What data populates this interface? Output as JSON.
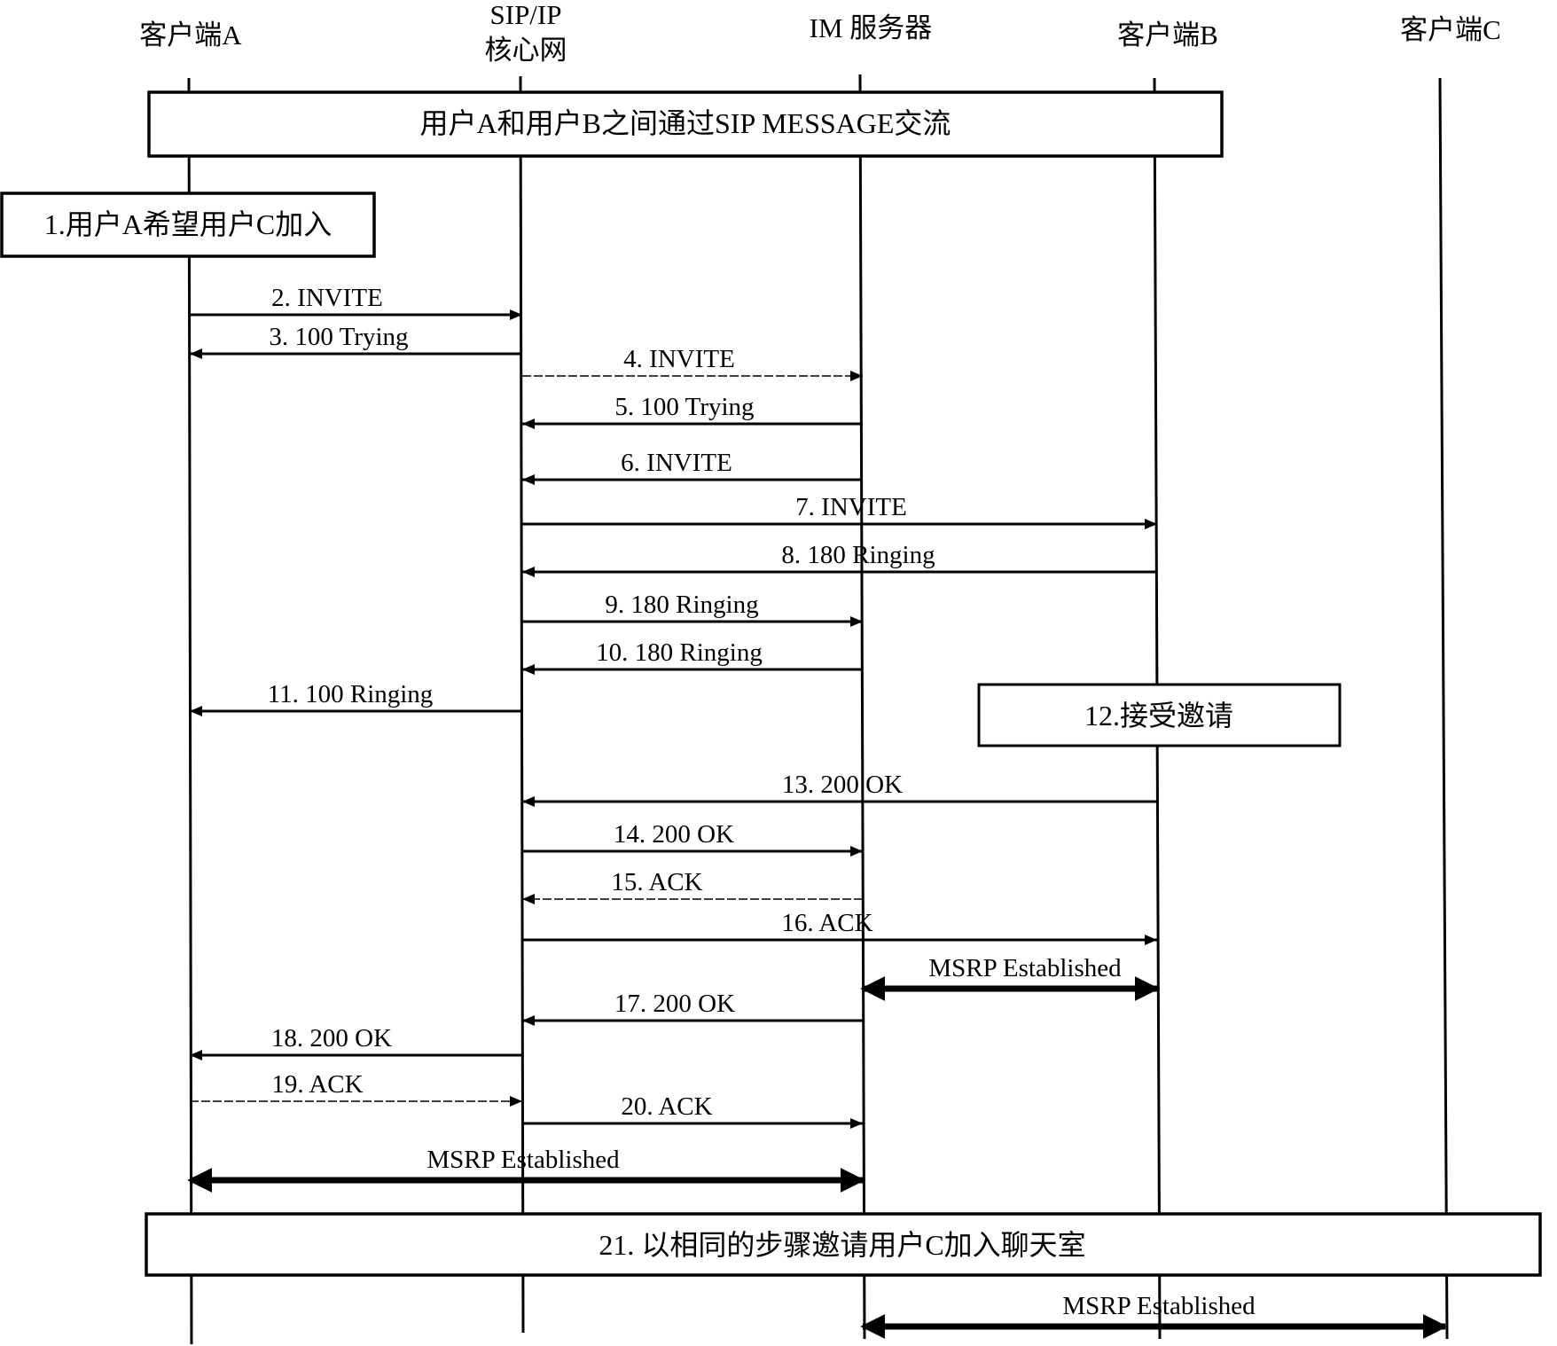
{
  "diagram": {
    "type": "sequence",
    "participants": [
      {
        "id": "A",
        "label": "客户端A"
      },
      {
        "id": "SIP",
        "label": "SIP/IP",
        "label2": "核心网"
      },
      {
        "id": "IM",
        "label": "IM 服务器"
      },
      {
        "id": "B",
        "label": "客户端B"
      },
      {
        "id": "C",
        "label": "客户端C"
      }
    ],
    "notes": [
      {
        "id": "note-sip-message",
        "text": "用户A和用户B之间通过SIP MESSAGE交流"
      },
      {
        "id": "note-step-1",
        "text": "1.用户A希望用户C加入"
      },
      {
        "id": "note-step-12",
        "text": "12.接受邀请"
      },
      {
        "id": "note-step-21",
        "text": "21. 以相同的步骤邀请用户C加入聊天室"
      }
    ],
    "messages": [
      {
        "label": "2. INVITE",
        "from": "A",
        "to": "SIP",
        "style": "solid"
      },
      {
        "label": "3. 100 Trying",
        "from": "SIP",
        "to": "A",
        "style": "solid"
      },
      {
        "label": "4. INVITE",
        "from": "SIP",
        "to": "IM",
        "style": "dashed"
      },
      {
        "label": "5. 100 Trying",
        "from": "IM",
        "to": "SIP",
        "style": "solid"
      },
      {
        "label": "6. INVITE",
        "from": "IM",
        "to": "SIP",
        "style": "solid"
      },
      {
        "label": "7. INVITE",
        "from": "SIP",
        "to": "B",
        "style": "solid"
      },
      {
        "label": "8. 180 Ringing",
        "from": "B",
        "to": "SIP",
        "style": "solid"
      },
      {
        "label": "9. 180 Ringing",
        "from": "SIP",
        "to": "IM",
        "style": "solid"
      },
      {
        "label": "10. 180 Ringing",
        "from": "IM",
        "to": "SIP",
        "style": "solid"
      },
      {
        "label": "11. 100 Ringing",
        "from": "SIP",
        "to": "A",
        "style": "solid"
      },
      {
        "label": "13. 200 OK",
        "from": "B",
        "to": "SIP",
        "style": "solid"
      },
      {
        "label": "14. 200 OK",
        "from": "SIP",
        "to": "IM",
        "style": "solid"
      },
      {
        "label": "15. ACK",
        "from": "IM",
        "to": "SIP",
        "style": "dashed"
      },
      {
        "label": "16. ACK",
        "from": "SIP",
        "to": "B",
        "style": "solid"
      },
      {
        "label": "MSRP Established",
        "from": "IM",
        "to": "B",
        "style": "double"
      },
      {
        "label": "17. 200 OK",
        "from": "IM",
        "to": "SIP",
        "style": "solid"
      },
      {
        "label": "18. 200 OK",
        "from": "SIP",
        "to": "A",
        "style": "solid"
      },
      {
        "label": "19. ACK",
        "from": "A",
        "to": "SIP",
        "style": "dashed"
      },
      {
        "label": "20. ACK",
        "from": "SIP",
        "to": "IM",
        "style": "solid"
      },
      {
        "label": "MSRP Established",
        "from": "A",
        "to": "IM",
        "style": "double"
      },
      {
        "label": "MSRP Established",
        "from": "IM",
        "to": "C",
        "style": "double"
      }
    ]
  }
}
